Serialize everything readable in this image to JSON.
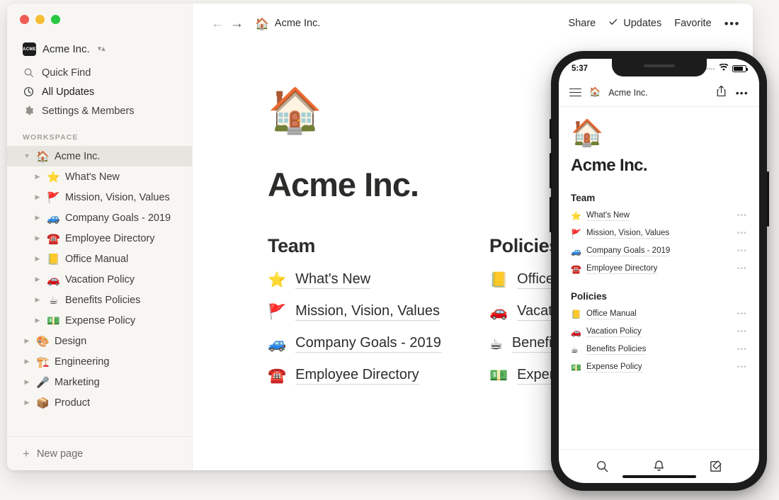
{
  "window": {
    "traffic_lights": [
      "close",
      "minimize",
      "maximize"
    ],
    "colors": {
      "close": "#f05b54",
      "minimize": "#f6bd31",
      "maximize": "#28c840",
      "background": "#f7f5f2",
      "sidebar": "#f7f6f3"
    }
  },
  "sidebar": {
    "workspace_switcher": {
      "logo_text": "ACME",
      "name": "Acme Inc.",
      "caret_icon": "chevron-updown-icon"
    },
    "nav": [
      {
        "label": "Quick Find",
        "icon": "search-icon"
      },
      {
        "label": "All Updates",
        "icon": "clock-icon"
      },
      {
        "label": "Settings & Members",
        "icon": "gear-icon"
      }
    ],
    "section_label": "WORKSPACE",
    "tree": [
      {
        "label": "Acme Inc.",
        "emoji": "🏠",
        "level": 0,
        "expanded": true,
        "active": true
      },
      {
        "label": "What's New",
        "emoji": "⭐",
        "level": 1,
        "expanded": false,
        "active": false
      },
      {
        "label": "Mission, Vision, Values",
        "emoji": "🚩",
        "level": 1,
        "expanded": false,
        "active": false
      },
      {
        "label": "Company Goals - 2019",
        "emoji": "🚙",
        "level": 1,
        "expanded": false,
        "active": false
      },
      {
        "label": "Employee Directory",
        "emoji": "☎️",
        "level": 1,
        "expanded": false,
        "active": false
      },
      {
        "label": "Office Manual",
        "emoji": "📒",
        "level": 1,
        "expanded": false,
        "active": false
      },
      {
        "label": "Vacation Policy",
        "emoji": "🚗",
        "level": 1,
        "expanded": false,
        "active": false
      },
      {
        "label": "Benefits Policies",
        "emoji": "☕",
        "level": 1,
        "expanded": false,
        "active": false
      },
      {
        "label": "Expense Policy",
        "emoji": "💵",
        "level": 1,
        "expanded": false,
        "active": false
      },
      {
        "label": "Design",
        "emoji": "🎨",
        "level": 0,
        "expanded": false,
        "active": false
      },
      {
        "label": "Engineering",
        "emoji": "🏗️",
        "level": 0,
        "expanded": false,
        "active": false
      },
      {
        "label": "Marketing",
        "emoji": "🎤",
        "level": 0,
        "expanded": false,
        "active": false
      },
      {
        "label": "Product",
        "emoji": "📦",
        "level": 0,
        "expanded": false,
        "active": false
      }
    ],
    "footer": {
      "label": "New page",
      "icon": "plus-icon"
    }
  },
  "topbar": {
    "back_icon": "arrow-left-icon",
    "forward_icon": "arrow-right-icon",
    "breadcrumb": {
      "emoji": "🏠",
      "label": "Acme Inc."
    },
    "share_label": "Share",
    "updates_label": "Updates",
    "updates_icon": "check-icon",
    "favorite_label": "Favorite",
    "more_icon": "ellipsis-icon"
  },
  "page": {
    "emoji": "🏠",
    "title": "Acme Inc.",
    "columns": [
      {
        "heading": "Team",
        "links": [
          {
            "emoji": "⭐",
            "label": "What's New"
          },
          {
            "emoji": "🚩",
            "label": "Mission, Vision, Values"
          },
          {
            "emoji": "🚙",
            "label": "Company Goals - 2019"
          },
          {
            "emoji": "☎️",
            "label": "Employee Directory"
          }
        ]
      },
      {
        "heading": "Policies",
        "links": [
          {
            "emoji": "📒",
            "label": "Office Manual"
          },
          {
            "emoji": "🚗",
            "label": "Vacation Policy"
          },
          {
            "emoji": "☕",
            "label": "Benefits Policies"
          },
          {
            "emoji": "💵",
            "label": "Expense Policy"
          }
        ]
      }
    ]
  },
  "phone": {
    "status": {
      "time": "5:37",
      "signal_icon": "signal-dots-icon",
      "wifi_icon": "wifi-icon",
      "battery_icon": "battery-icon"
    },
    "header": {
      "menu_icon": "hamburger-menu-icon",
      "emoji": "🏠",
      "title": "Acme Inc.",
      "share_icon": "share-icon",
      "more_icon": "ellipsis-icon"
    },
    "page": {
      "emoji": "🏠",
      "title": "Acme Inc.",
      "sections": [
        {
          "heading": "Team",
          "links": [
            {
              "emoji": "⭐",
              "label": "What's New",
              "more": "•••"
            },
            {
              "emoji": "🚩",
              "label": "Mission, Vision, Values",
              "more": "•••"
            },
            {
              "emoji": "🚙",
              "label": "Company Goals - 2019",
              "more": "•••"
            },
            {
              "emoji": "☎️",
              "label": "Employee Directory",
              "more": "•••"
            }
          ]
        },
        {
          "heading": "Policies",
          "links": [
            {
              "emoji": "📒",
              "label": "Office Manual",
              "more": "•••"
            },
            {
              "emoji": "🚗",
              "label": "Vacation Policy",
              "more": "•••"
            },
            {
              "emoji": "☕",
              "label": "Benefits Policies",
              "more": "•••"
            },
            {
              "emoji": "💵",
              "label": "Expense Policy",
              "more": "•••"
            }
          ]
        }
      ]
    },
    "tabbar": [
      {
        "icon": "search-icon"
      },
      {
        "icon": "bell-icon"
      },
      {
        "icon": "compose-icon"
      }
    ]
  }
}
